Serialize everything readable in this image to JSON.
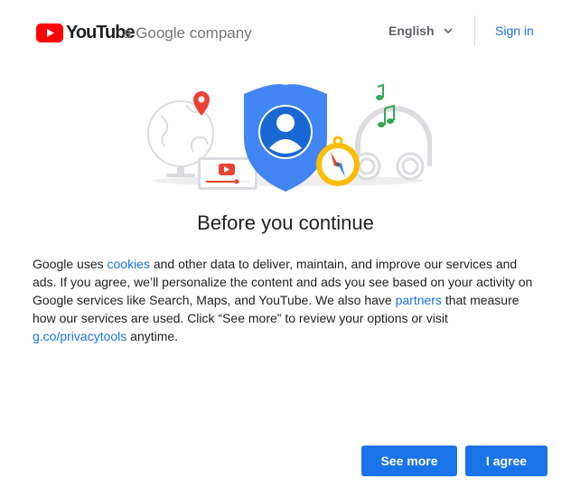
{
  "header": {
    "logo_text": "YouTube",
    "company_text": "a Google company",
    "language": {
      "selected": "English",
      "icon": "chevron-down-icon"
    },
    "sign_in_label": "Sign in"
  },
  "illustration": {
    "icons": [
      "globe-icon",
      "map-pin-icon",
      "video-player-icon",
      "shield-account-icon",
      "compass-icon",
      "headphones-icon",
      "music-note-icon"
    ]
  },
  "main": {
    "title": "Before you continue",
    "paragraph": {
      "t1": "Google uses ",
      "link_cookies": "cookies",
      "t2": " and other data to deliver, maintain, and improve our services and ads. If you agree, we’ll personalize the content and ads you see based on your activity on Google services like Search, Maps, and YouTube. We also have ",
      "link_partners": "partners",
      "t3": " that measure how our services are used. Click “See more” to review your options or visit ",
      "link_privacytools": "g.co/privacytools",
      "t4": " anytime."
    }
  },
  "actions": {
    "see_more_label": "See more",
    "agree_label": "I agree"
  },
  "colors": {
    "accent": "#1a73e8",
    "youtube_red": "#ff0000",
    "shield_blue": "#4285f4",
    "green": "#34a853",
    "yellow": "#fbbc04",
    "divider": "#dadce0"
  }
}
